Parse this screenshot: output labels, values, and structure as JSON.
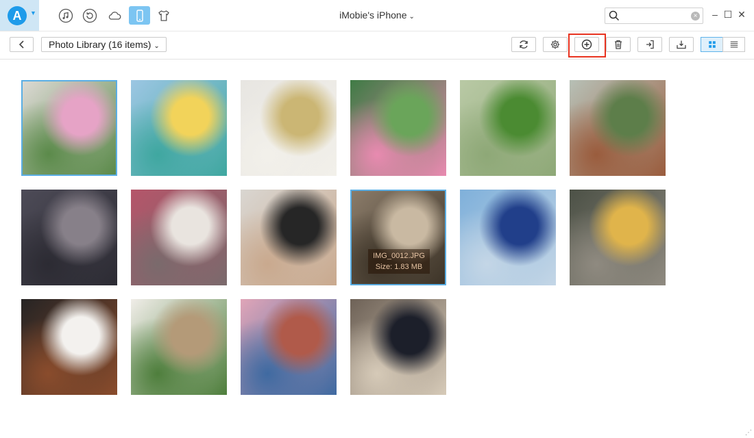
{
  "window": {
    "title": "iMobie's iPhone"
  },
  "categories": [
    {
      "name": "music"
    },
    {
      "name": "restore"
    },
    {
      "name": "cloud"
    },
    {
      "name": "phone",
      "active": true
    },
    {
      "name": "tshirt"
    }
  ],
  "toolbar": {
    "library_label": "Photo Library (16 items)"
  },
  "photos": [
    {
      "colors": [
        "#dcd9d4",
        "#e6a3c6",
        "#5b8a4a"
      ],
      "selected": true
    },
    {
      "colors": [
        "#9cc6e3",
        "#f2d35a",
        "#3fa7a0"
      ]
    },
    {
      "colors": [
        "#e8e6e2",
        "#cbb674",
        "#f2f0ea"
      ]
    },
    {
      "colors": [
        "#3f7b45",
        "#6aa55a",
        "#e88ab0"
      ]
    },
    {
      "colors": [
        "#b9c9a5",
        "#4b8b32",
        "#8ea877"
      ]
    },
    {
      "colors": [
        "#b7c0b6",
        "#5d7e4a",
        "#9a5c3d"
      ]
    },
    {
      "colors": [
        "#4d4b57",
        "#878089",
        "#2c2b33"
      ]
    },
    {
      "colors": [
        "#b5556a",
        "#e9e4df",
        "#7a6a6c"
      ]
    },
    {
      "colors": [
        "#d9d6d1",
        "#262626",
        "#c9a98e"
      ]
    },
    {
      "colors": [
        "#8a7b69",
        "#c9b9a2",
        "#3d3428"
      ],
      "selected": true,
      "info": {
        "name": "IMG_0012.JPG",
        "size": "Size: 1.83 MB"
      }
    },
    {
      "colors": [
        "#7fb0da",
        "#213f8a",
        "#c4d6e6"
      ]
    },
    {
      "colors": [
        "#4c5146",
        "#e0b44b",
        "#8f8a80"
      ]
    },
    {
      "colors": [
        "#262424",
        "#f3f1ee",
        "#8a4c2c"
      ]
    },
    {
      "colors": [
        "#f0ede8",
        "#b49a78",
        "#4e7e3c"
      ]
    },
    {
      "colors": [
        "#e0a5b8",
        "#b05a4a",
        "#3f6aa1"
      ]
    },
    {
      "colors": [
        "#6e6257",
        "#1c1f2a",
        "#d6cab8"
      ]
    }
  ],
  "accent": "#1e9bea",
  "highlight_color": "#e8321f"
}
